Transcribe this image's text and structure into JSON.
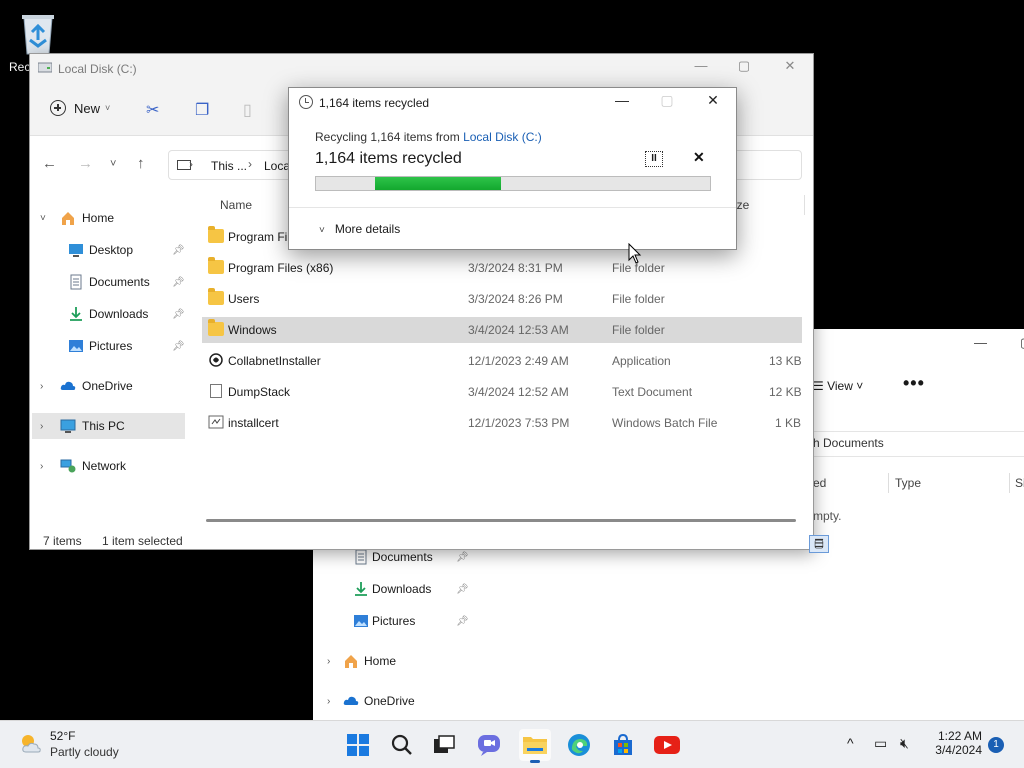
{
  "desktop": {
    "recycle_bin_label": "Rec"
  },
  "back_window": {
    "view_label": "View",
    "more_label": "•••",
    "address_fragment": "h Documents",
    "col_type": "Type",
    "col_modified_fragment": "ed",
    "col_size_fragment": "Si",
    "empty_fragment": "mpty.",
    "nav": [
      {
        "label": "Documents",
        "pinned": true
      },
      {
        "label": "Downloads",
        "pinned": true
      },
      {
        "label": "Pictures",
        "pinned": true
      },
      {
        "label": "Home",
        "expandable": true
      },
      {
        "label": "OneDrive",
        "expandable": true
      }
    ]
  },
  "explorer": {
    "title": "Local Disk (C:)",
    "new_label": "New",
    "address": {
      "seg1": "This ...",
      "seg2": "Loca"
    },
    "columns": {
      "name": "Name",
      "size_fragment": "ize"
    },
    "sidebar": [
      {
        "label": "Home",
        "expanded": true
      },
      {
        "label": "Desktop",
        "pinned": true
      },
      {
        "label": "Documents",
        "pinned": true
      },
      {
        "label": "Downloads",
        "pinned": true
      },
      {
        "label": "Pictures",
        "pinned": true
      },
      {
        "label": "OneDrive"
      },
      {
        "label": "This PC",
        "selected": true
      },
      {
        "label": "Network"
      }
    ],
    "files": [
      {
        "name": "Program Fil",
        "date": "",
        "type": "",
        "size": "",
        "kind": "folder"
      },
      {
        "name": "Program Files (x86)",
        "date": "3/3/2024 8:31 PM",
        "type": "File folder",
        "size": "",
        "kind": "folder"
      },
      {
        "name": "Users",
        "date": "3/3/2024 8:26 PM",
        "type": "File folder",
        "size": "",
        "kind": "folder"
      },
      {
        "name": "Windows",
        "date": "3/4/2024 12:53 AM",
        "type": "File folder",
        "size": "",
        "kind": "folder",
        "selected": true
      },
      {
        "name": "CollabnetInstaller",
        "date": "12/1/2023 2:49 AM",
        "type": "Application",
        "size": "13 KB",
        "kind": "app"
      },
      {
        "name": "DumpStack",
        "date": "3/4/2024 12:52 AM",
        "type": "Text Document",
        "size": "12 KB",
        "kind": "doc"
      },
      {
        "name": "installcert",
        "date": "12/1/2023 7:53 PM",
        "type": "Windows Batch File",
        "size": "1 KB",
        "kind": "bat"
      }
    ],
    "status": {
      "count": "7 items",
      "selection": "1 item selected"
    }
  },
  "dialog": {
    "title": "1,164 items recycled",
    "subtitle_prefix": "Recycling 1,164 items from ",
    "subtitle_link": "Local Disk (C:)",
    "headline": "1,164 items recycled",
    "progress": {
      "segment_start": 0.15,
      "segment_end": 0.47
    },
    "more_details": "More details",
    "accent": "#13a82e"
  },
  "taskbar": {
    "weather_temp": "52°F",
    "weather_cond": "Partly cloudy",
    "time": "1:22 AM",
    "date": "3/4/2024",
    "notification_count": "1",
    "apps": [
      "start-icon",
      "search-icon",
      "task-view-icon",
      "chat-icon",
      "file-explorer-icon",
      "edge-icon",
      "store-icon",
      "youtube-icon"
    ]
  }
}
